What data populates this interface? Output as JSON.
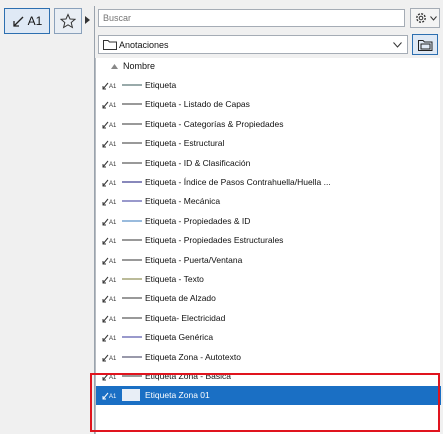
{
  "toolbar": {
    "search_placeholder": "Buscar",
    "folder_value": "Anotaciones",
    "label_tool_text": "A1"
  },
  "list": {
    "column_header": "Nombre",
    "items": [
      {
        "label": "Etiqueta",
        "selected": false
      },
      {
        "label": "Etiqueta -  Listado de Capas",
        "selected": false
      },
      {
        "label": "Etiqueta - Categorías & Propiedades",
        "selected": false
      },
      {
        "label": "Etiqueta - Estructural",
        "selected": false
      },
      {
        "label": "Etiqueta - ID & Clasificación",
        "selected": false
      },
      {
        "label": "Etiqueta - Índice de Pasos Contrahuella/Huella ...",
        "selected": false
      },
      {
        "label": "Etiqueta - Mecánica",
        "selected": false
      },
      {
        "label": "Etiqueta - Propiedades & ID",
        "selected": false
      },
      {
        "label": "Etiqueta - Propiedades Estructurales",
        "selected": false
      },
      {
        "label": "Etiqueta - Puerta/Ventana",
        "selected": false
      },
      {
        "label": "Etiqueta - Texto",
        "selected": false
      },
      {
        "label": "Etiqueta de Alzado",
        "selected": false
      },
      {
        "label": "Etiqueta- Electricidad",
        "selected": false
      },
      {
        "label": "Etiqueta Genérica",
        "selected": false
      },
      {
        "label": "Etiqueta Zona - Autotexto",
        "selected": false
      },
      {
        "label": "Etiqueta Zona - Básica",
        "selected": false
      },
      {
        "label": "Etiqueta Zona 01",
        "selected": true
      }
    ]
  },
  "colors": {
    "highlight_border": "#e0141e",
    "selection": "#1a6fc4",
    "accent_border": "#2d6fb0"
  }
}
